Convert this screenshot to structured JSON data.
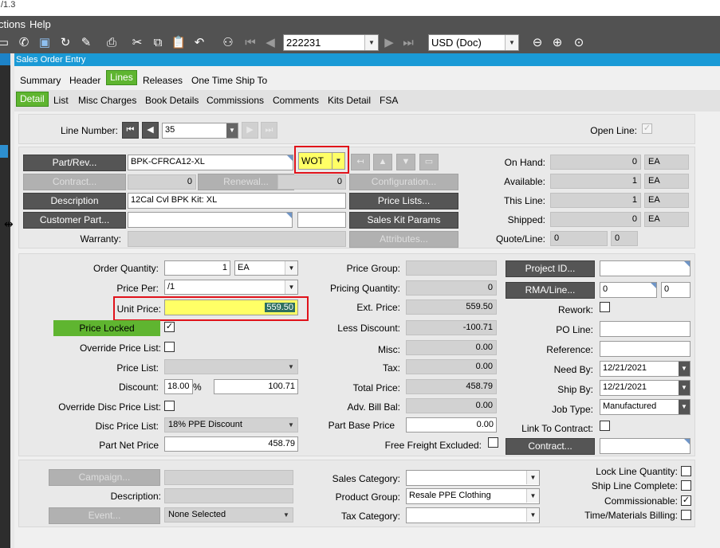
{
  "app": {
    "version_fragment": "/1.3"
  },
  "menubar": {
    "items": [
      "ctions",
      "Help"
    ]
  },
  "toolbar": {
    "record_value": "222231",
    "currency_value": "USD (Doc)"
  },
  "window": {
    "title": "Sales Order Entry"
  },
  "tabs": [
    "Summary",
    "Header",
    "Lines",
    "Releases",
    "One Time Ship To"
  ],
  "subtabs": [
    "Detail",
    "List",
    "Misc Charges",
    "Book Details",
    "Commissions",
    "Comments",
    "Kits Detail",
    "FSA"
  ],
  "line": {
    "line_number_label": "Line Number:",
    "line_number": "35",
    "open_line_label": "Open Line:",
    "open_line_checked": true
  },
  "part": {
    "part_rev_button": "Part/Rev...",
    "part_value": "BPK-CFRCA12-XL",
    "rev_value": "WOT",
    "contract_button": "Contract...",
    "contract_value": "0",
    "renewal_button": "Renewal...",
    "renewal_value": "0",
    "configuration_button": "Configuration...",
    "description_button": "Description",
    "description_value": "12Cal Cvl BPK Kit: XL",
    "price_lists_button": "Price Lists...",
    "customer_part_button": "Customer Part...",
    "customer_part_value": "",
    "customer_part_rev": "",
    "sales_kit_params_button": "Sales Kit Params",
    "warranty_label": "Warranty:",
    "warranty_value": "",
    "attributes_button": "Attributes..."
  },
  "quantities": {
    "on_hand_label": "On Hand:",
    "on_hand": "0",
    "on_hand_uom": "EA",
    "available_label": "Available:",
    "available": "1",
    "available_uom": "EA",
    "this_line_label": "This Line:",
    "this_line": "1",
    "this_line_uom": "EA",
    "shipped_label": "Shipped:",
    "shipped": "0",
    "shipped_uom": "EA",
    "quote_line_label": "Quote/Line:",
    "quote": "0",
    "quote_line": "0"
  },
  "pricing": {
    "order_quantity_label": "Order Quantity:",
    "order_quantity": "1",
    "order_uom": "EA",
    "price_per_label": "Price Per:",
    "price_per": "/1",
    "unit_price_label": "Unit Price:",
    "unit_price": "559.50",
    "price_locked_label": "Price Locked",
    "price_locked_checked": true,
    "override_price_list_label": "Override Price List:",
    "override_price_list_checked": false,
    "price_list_label": "Price List:",
    "price_list": "",
    "discount_label": "Discount:",
    "discount_percent": "18.00",
    "percent_sign": "%",
    "discount_amount": "100.71",
    "override_disc_price_list_label": "Override Disc Price List:",
    "override_disc_checked": false,
    "disc_price_list_label": "Disc Price List:",
    "disc_price_list": "18% PPE Discount",
    "part_net_price_label": "Part Net Price",
    "part_net_price": "458.79"
  },
  "totals": {
    "price_group_label": "Price Group:",
    "price_group": "",
    "pricing_quantity_label": "Pricing Quantity:",
    "pricing_quantity": "0",
    "ext_price_label": "Ext. Price:",
    "ext_price": "559.50",
    "less_discount_label": "Less Discount:",
    "less_discount": "-100.71",
    "misc_label": "Misc:",
    "misc": "0.00",
    "tax_label": "Tax:",
    "tax": "0.00",
    "total_price_label": "Total Price:",
    "total_price": "458.79",
    "adv_bill_bal_label": "Adv. Bill Bal:",
    "adv_bill_bal": "0.00",
    "part_base_price_label": "Part Base Price",
    "part_base_price": "0.00",
    "free_freight_label": "Free Freight Excluded:",
    "free_freight_checked": false
  },
  "project": {
    "project_id_button": "Project ID...",
    "project_id": "",
    "rma_line_button": "RMA/Line...",
    "rma": "0",
    "rma_line": "0",
    "rework_label": "Rework:",
    "rework_checked": false,
    "po_line_label": "PO Line:",
    "po_line": "",
    "reference_label": "Reference:",
    "reference": "",
    "need_by_label": "Need By:",
    "need_by": "12/21/2021",
    "ship_by_label": "Ship By:",
    "ship_by": "12/21/2021",
    "job_type_label": "Job Type:",
    "job_type": "Manufactured",
    "link_to_contract_label": "Link To Contract:",
    "link_to_contract_checked": false,
    "contract_button": "Contract...",
    "contract_value": ""
  },
  "bottom": {
    "campaign_button": "Campaign...",
    "campaign_value": "",
    "description_label": "Description:",
    "description_value": "",
    "event_button": "Event...",
    "event_value": "None Selected",
    "sales_category_label": "Sales Category:",
    "sales_category": "",
    "product_group_label": "Product Group:",
    "product_group": "Resale PPE Clothing",
    "tax_category_label": "Tax Category:",
    "tax_category": "",
    "lock_line_quantity_label": "Lock Line Quantity:",
    "lock_line_quantity_checked": false,
    "ship_line_complete_label": "Ship Line Complete:",
    "ship_line_complete_checked": false,
    "commissionable_label": "Commissionable:",
    "commissionable_checked": true,
    "time_materials_label": "Time/Materials Billing:",
    "time_materials_checked": false
  },
  "colors": {
    "accent_green": "#5fb530",
    "highlight_yellow": "#ffff66",
    "highlight_red": "#e0121a",
    "title_blue": "#1a9ad6"
  }
}
